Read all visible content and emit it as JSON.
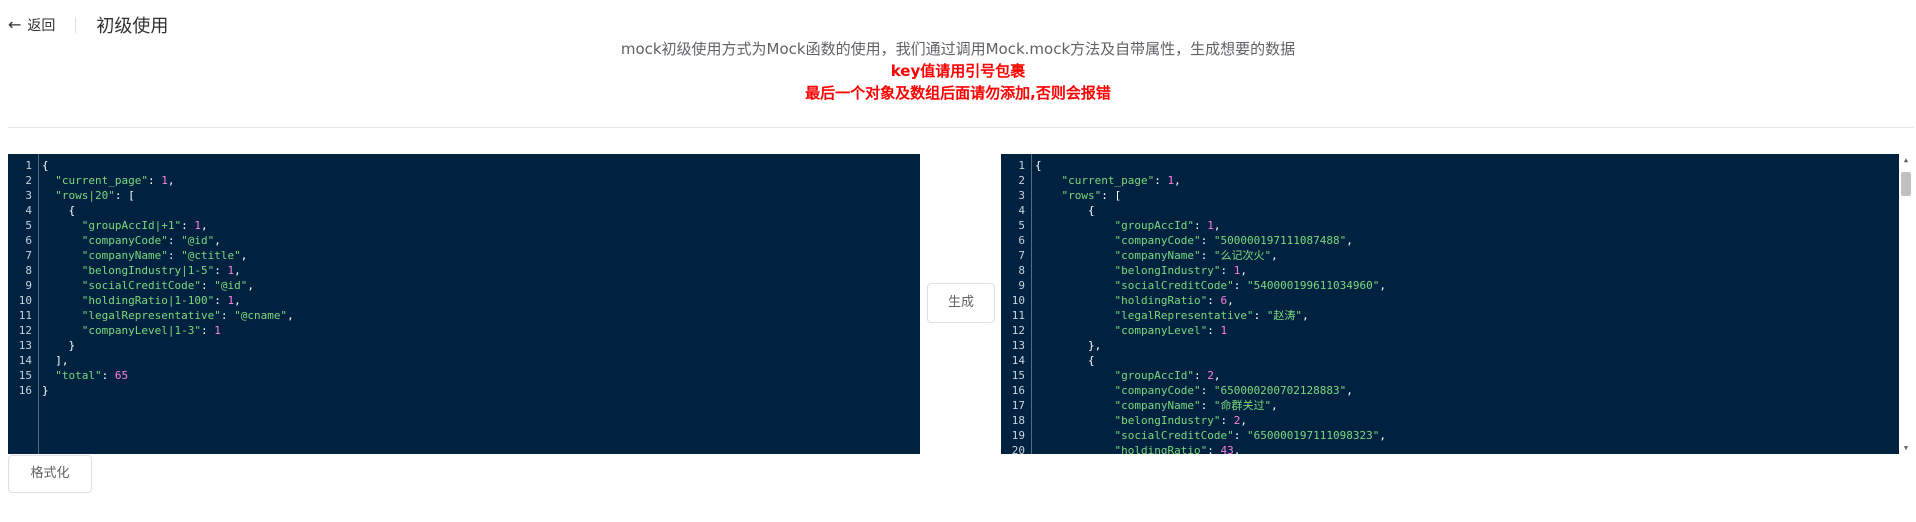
{
  "header": {
    "back_label": "返回",
    "title": "初级使用"
  },
  "description": {
    "line": "mock初级使用方式为Mock函数的使用，我们通过调用Mock.mock方法及自带属性，生成想要的数据",
    "warnings": [
      "key值请用引号包裹",
      "最后一个对象及数组后面请勿添加,否则会报错"
    ]
  },
  "buttons": {
    "generate_label": "生成",
    "format_label": "格式化"
  },
  "icons": {
    "back": "arrow-left-icon",
    "scroll_up": "triangle-up-icon",
    "scroll_down": "triangle-down-icon"
  },
  "colors": {
    "editor_bg": "#002240",
    "key": "#7cd97c",
    "number": "#ff80e1",
    "warning": "#ff0000"
  },
  "left_editor": {
    "line_numbers": [
      "1",
      "2",
      "3",
      "4",
      "5",
      "6",
      "7",
      "8",
      "9",
      "10",
      "11",
      "12",
      "13",
      "14",
      "15",
      "16"
    ],
    "lines": [
      [
        [
          "p",
          "{"
        ]
      ],
      [
        [
          "p",
          "  "
        ],
        [
          "k",
          "\"current_page\""
        ],
        [
          "p",
          ": "
        ],
        [
          "n",
          "1"
        ],
        [
          "p",
          ","
        ]
      ],
      [
        [
          "p",
          "  "
        ],
        [
          "k",
          "\"rows|20\""
        ],
        [
          "p",
          ": ["
        ]
      ],
      [
        [
          "p",
          "    {"
        ]
      ],
      [
        [
          "p",
          "      "
        ],
        [
          "k",
          "\"groupAccId|+1\""
        ],
        [
          "p",
          ": "
        ],
        [
          "n",
          "1"
        ],
        [
          "p",
          ","
        ]
      ],
      [
        [
          "p",
          "      "
        ],
        [
          "k",
          "\"companyCode\""
        ],
        [
          "p",
          ": "
        ],
        [
          "s",
          "\"@id\""
        ],
        [
          "p",
          ","
        ]
      ],
      [
        [
          "p",
          "      "
        ],
        [
          "k",
          "\"companyName\""
        ],
        [
          "p",
          ": "
        ],
        [
          "s",
          "\"@ctitle\""
        ],
        [
          "p",
          ","
        ]
      ],
      [
        [
          "p",
          "      "
        ],
        [
          "k",
          "\"belongIndustry|1-5\""
        ],
        [
          "p",
          ": "
        ],
        [
          "n",
          "1"
        ],
        [
          "p",
          ","
        ]
      ],
      [
        [
          "p",
          "      "
        ],
        [
          "k",
          "\"socialCreditCode\""
        ],
        [
          "p",
          ": "
        ],
        [
          "s",
          "\"@id\""
        ],
        [
          "p",
          ","
        ]
      ],
      [
        [
          "p",
          "      "
        ],
        [
          "k",
          "\"holdingRatio|1-100\""
        ],
        [
          "p",
          ": "
        ],
        [
          "n",
          "1"
        ],
        [
          "p",
          ","
        ]
      ],
      [
        [
          "p",
          "      "
        ],
        [
          "k",
          "\"legalRepresentative\""
        ],
        [
          "p",
          ": "
        ],
        [
          "s",
          "\"@cname\""
        ],
        [
          "p",
          ","
        ]
      ],
      [
        [
          "p",
          "      "
        ],
        [
          "k",
          "\"companyLevel|1-3\""
        ],
        [
          "p",
          ": "
        ],
        [
          "n",
          "1"
        ]
      ],
      [
        [
          "p",
          "    }"
        ]
      ],
      [
        [
          "p",
          "  ],"
        ]
      ],
      [
        [
          "p",
          "  "
        ],
        [
          "k",
          "\"total\""
        ],
        [
          "p",
          ": "
        ],
        [
          "n",
          "65"
        ]
      ],
      [
        [
          "p",
          "}"
        ]
      ]
    ]
  },
  "right_editor": {
    "line_numbers": [
      "1",
      "2",
      "3",
      "4",
      "5",
      "6",
      "7",
      "8",
      "9",
      "10",
      "11",
      "12",
      "13",
      "14",
      "15",
      "16",
      "17",
      "18",
      "19",
      "20"
    ],
    "lines": [
      [
        [
          "p",
          "{"
        ]
      ],
      [
        [
          "p",
          "    "
        ],
        [
          "k",
          "\"current_page\""
        ],
        [
          "p",
          ": "
        ],
        [
          "n",
          "1"
        ],
        [
          "p",
          ","
        ]
      ],
      [
        [
          "p",
          "    "
        ],
        [
          "k",
          "\"rows\""
        ],
        [
          "p",
          ": ["
        ]
      ],
      [
        [
          "p",
          "        {"
        ]
      ],
      [
        [
          "p",
          "            "
        ],
        [
          "k",
          "\"groupAccId\""
        ],
        [
          "p",
          ": "
        ],
        [
          "n",
          "1"
        ],
        [
          "p",
          ","
        ]
      ],
      [
        [
          "p",
          "            "
        ],
        [
          "k",
          "\"companyCode\""
        ],
        [
          "p",
          ": "
        ],
        [
          "s",
          "\"500000197111087488\""
        ],
        [
          "p",
          ","
        ]
      ],
      [
        [
          "p",
          "            "
        ],
        [
          "k",
          "\"companyName\""
        ],
        [
          "p",
          ": "
        ],
        [
          "s",
          "\"么记次火\""
        ],
        [
          "p",
          ","
        ]
      ],
      [
        [
          "p",
          "            "
        ],
        [
          "k",
          "\"belongIndustry\""
        ],
        [
          "p",
          ": "
        ],
        [
          "n",
          "1"
        ],
        [
          "p",
          ","
        ]
      ],
      [
        [
          "p",
          "            "
        ],
        [
          "k",
          "\"socialCreditCode\""
        ],
        [
          "p",
          ": "
        ],
        [
          "s",
          "\"540000199611034960\""
        ],
        [
          "p",
          ","
        ]
      ],
      [
        [
          "p",
          "            "
        ],
        [
          "k",
          "\"holdingRatio\""
        ],
        [
          "p",
          ": "
        ],
        [
          "n",
          "6"
        ],
        [
          "p",
          ","
        ]
      ],
      [
        [
          "p",
          "            "
        ],
        [
          "k",
          "\"legalRepresentative\""
        ],
        [
          "p",
          ": "
        ],
        [
          "s",
          "\"赵涛\""
        ],
        [
          "p",
          ","
        ]
      ],
      [
        [
          "p",
          "            "
        ],
        [
          "k",
          "\"companyLevel\""
        ],
        [
          "p",
          ": "
        ],
        [
          "n",
          "1"
        ]
      ],
      [
        [
          "p",
          "        },"
        ]
      ],
      [
        [
          "p",
          "        {"
        ]
      ],
      [
        [
          "p",
          "            "
        ],
        [
          "k",
          "\"groupAccId\""
        ],
        [
          "p",
          ": "
        ],
        [
          "n",
          "2"
        ],
        [
          "p",
          ","
        ]
      ],
      [
        [
          "p",
          "            "
        ],
        [
          "k",
          "\"companyCode\""
        ],
        [
          "p",
          ": "
        ],
        [
          "s",
          "\"650000200702128883\""
        ],
        [
          "p",
          ","
        ]
      ],
      [
        [
          "p",
          "            "
        ],
        [
          "k",
          "\"companyName\""
        ],
        [
          "p",
          ": "
        ],
        [
          "s",
          "\"命群关过\""
        ],
        [
          "p",
          ","
        ]
      ],
      [
        [
          "p",
          "            "
        ],
        [
          "k",
          "\"belongIndustry\""
        ],
        [
          "p",
          ": "
        ],
        [
          "n",
          "2"
        ],
        [
          "p",
          ","
        ]
      ],
      [
        [
          "p",
          "            "
        ],
        [
          "k",
          "\"socialCreditCode\""
        ],
        [
          "p",
          ": "
        ],
        [
          "s",
          "\"650000197111098323\""
        ],
        [
          "p",
          ","
        ]
      ],
      [
        [
          "p",
          "            "
        ],
        [
          "k",
          "\"holdingRatio\""
        ],
        [
          "p",
          ": "
        ],
        [
          "n",
          "43"
        ],
        [
          "p",
          ","
        ]
      ]
    ]
  }
}
